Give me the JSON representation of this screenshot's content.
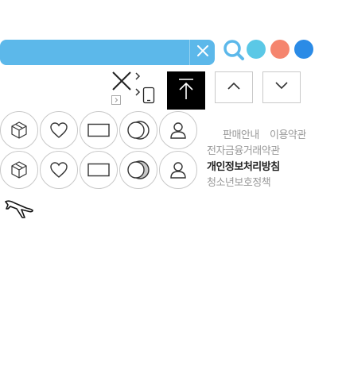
{
  "search": {
    "input_value": "",
    "placeholder": "",
    "bar_color": "#5cb8ea",
    "clear_icon": "close-icon"
  },
  "color_dots": [
    {
      "color": "#5bc8e6"
    },
    {
      "color": "#f5856e"
    },
    {
      "color": "#2b8be6"
    }
  ],
  "controls": {
    "close_icon": "close-icon",
    "chevron_icon": "chevron-right-icon",
    "mobile_icon": "mobile-phone-icon",
    "scroll_top_icon": "arrow-to-top-icon",
    "scroll_top_bg": "#000000",
    "page_up_icon": "chevron-up-icon",
    "page_down_icon": "chevron-down-icon"
  },
  "quick_icons": [
    {
      "name": "box-icon"
    },
    {
      "name": "heart-icon"
    },
    {
      "name": "rectangle-icon"
    },
    {
      "name": "toggle-circles-icon"
    },
    {
      "name": "user-icon"
    }
  ],
  "footer_links": {
    "row1": [
      "판매안내",
      "이용약관"
    ],
    "row2": "전자금융거래약관",
    "row3": "개인정보처리방침",
    "row4": "청소년보호정책"
  },
  "airplane_icon": "airplane-icon"
}
